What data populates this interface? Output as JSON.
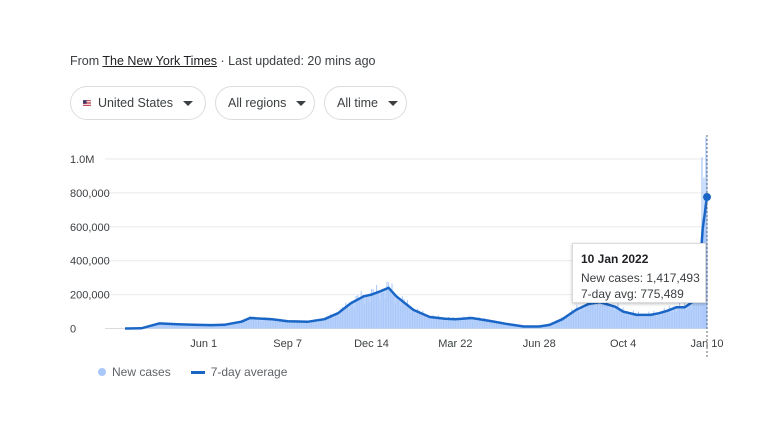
{
  "source": {
    "prefix": "From",
    "name": "The New York Times",
    "updated": "· Last updated: 20 mins ago"
  },
  "filters": {
    "country": "United States",
    "region": "All regions",
    "time": "All time"
  },
  "colors": {
    "bars": "#a8c7fa",
    "line": "#1a66c6",
    "grid": "#e8eaed"
  },
  "icons": [
    "us-flag-icon",
    "dropdown-arrow-icon"
  ],
  "tooltip": {
    "date": "10 Jan 2022",
    "new_cases": "New cases: 1,417,493",
    "avg": "7-day avg: 775,489"
  },
  "legend": {
    "new_cases": "New cases",
    "avg": "7-day average"
  },
  "chart_data": {
    "type": "area",
    "title": "",
    "xlabel": "",
    "ylabel": "",
    "y_ticks": [
      "0",
      "200,000",
      "400,000",
      "600,000",
      "800,000",
      "1.0M"
    ],
    "x_ticks": [
      "Jun 1",
      "Sep 7",
      "Dec 14",
      "Mar 22",
      "Jun 28",
      "Oct 4",
      "Jan 10"
    ],
    "ylim": [
      0,
      1000000
    ],
    "grid": true,
    "legend_position": "bottom-left",
    "x": [
      "2020-03-01",
      "2020-03-20",
      "2020-04-10",
      "2020-05-01",
      "2020-05-20",
      "2020-06-10",
      "2020-06-25",
      "2020-07-15",
      "2020-07-25",
      "2020-08-20",
      "2020-09-07",
      "2020-10-01",
      "2020-10-20",
      "2020-11-05",
      "2020-11-20",
      "2020-12-05",
      "2020-12-14",
      "2020-12-22",
      "2021-01-03",
      "2021-01-12",
      "2021-02-01",
      "2021-02-20",
      "2021-03-10",
      "2021-03-22",
      "2021-04-10",
      "2021-05-01",
      "2021-05-20",
      "2021-06-10",
      "2021-06-28",
      "2021-07-10",
      "2021-07-25",
      "2021-08-10",
      "2021-08-25",
      "2021-09-07",
      "2021-09-25",
      "2021-10-04",
      "2021-10-20",
      "2021-11-05",
      "2021-11-15",
      "2021-11-25",
      "2021-12-05",
      "2021-12-15",
      "2021-12-25",
      "2022-01-01",
      "2022-01-05",
      "2022-01-10"
    ],
    "series": [
      {
        "name": "7-day average",
        "values": [
          0,
          1000,
          30000,
          25000,
          22000,
          20000,
          22000,
          40000,
          62000,
          55000,
          43000,
          40000,
          55000,
          90000,
          150000,
          190000,
          200000,
          215000,
          240000,
          190000,
          110000,
          68000,
          58000,
          55000,
          62000,
          45000,
          28000,
          12000,
          12000,
          21000,
          55000,
          110000,
          145000,
          155000,
          128000,
          100000,
          80000,
          80000,
          90000,
          105000,
          125000,
          125000,
          160000,
          300000,
          590000,
          775489
        ]
      }
    ],
    "highlight": {
      "date": "2022-01-10",
      "new_cases": 1417493,
      "avg": 775489
    }
  }
}
